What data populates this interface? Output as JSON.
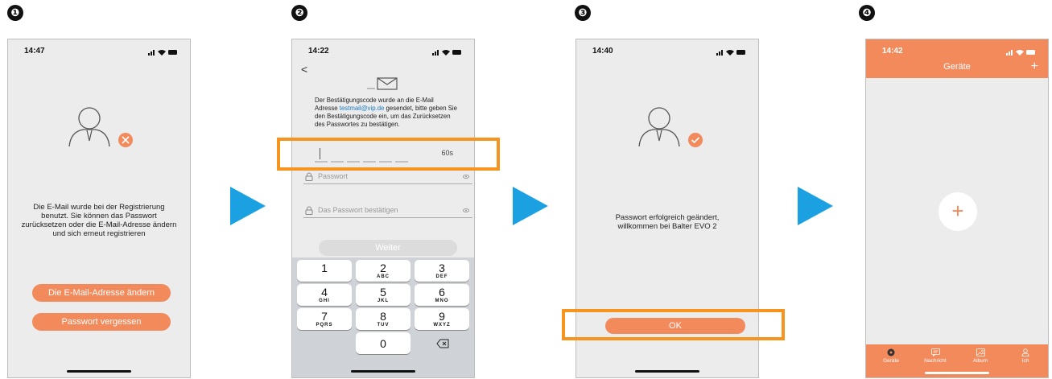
{
  "steps": [
    "❶",
    "❷",
    "❸",
    "❹"
  ],
  "colors": {
    "accent": "#f28a5c",
    "arrow": "#1ba1e2",
    "highlight": "#f7941d",
    "phone_bg": "#ececec"
  },
  "screen1": {
    "time": "14:47",
    "message": "Die E-Mail wurde bei der Registrierung benutzt. Sie können das Passwort zurücksetzen oder die E-Mail-Adresse ändern und sich erneut registrieren",
    "change_email_label": "Die E-Mail-Adresse ändern",
    "forgot_password_label": "Passwort vergessen"
  },
  "screen2": {
    "time": "14:22",
    "back_label": "<",
    "message_before": "Der Bestätigungscode wurde an die E-Mail Adresse ",
    "email": "testmail@vip.de",
    "message_after": " gesendet, bitte geben Sie den Bestätigungscode ein, um das Zurücksetzen des Passwortes zu bestätigen.",
    "countdown": "60s",
    "password_placeholder": "Passwort",
    "confirm_placeholder": "Das Passwort bestätigen",
    "continue_label": "Weiter",
    "keys": [
      {
        "n": "1",
        "l": ""
      },
      {
        "n": "2",
        "l": "ABC"
      },
      {
        "n": "3",
        "l": "DEF"
      },
      {
        "n": "4",
        "l": "GHI"
      },
      {
        "n": "5",
        "l": "JKL"
      },
      {
        "n": "6",
        "l": "MNO"
      },
      {
        "n": "7",
        "l": "PQRS"
      },
      {
        "n": "8",
        "l": "TUV"
      },
      {
        "n": "9",
        "l": "WXYZ"
      }
    ],
    "zero": "0"
  },
  "screen3": {
    "time": "14:40",
    "message": "Passwort erfolgreich geändert, willkommen bei Balter EVO 2",
    "ok_label": "OK"
  },
  "screen4": {
    "time": "14:42",
    "title": "Geräte",
    "add_label": "+",
    "tabs": [
      {
        "label": "Geräte",
        "icon": "devices-icon"
      },
      {
        "label": "Nachricht",
        "icon": "message-icon"
      },
      {
        "label": "Album",
        "icon": "album-icon"
      },
      {
        "label": "Ich",
        "icon": "user-icon"
      }
    ]
  }
}
